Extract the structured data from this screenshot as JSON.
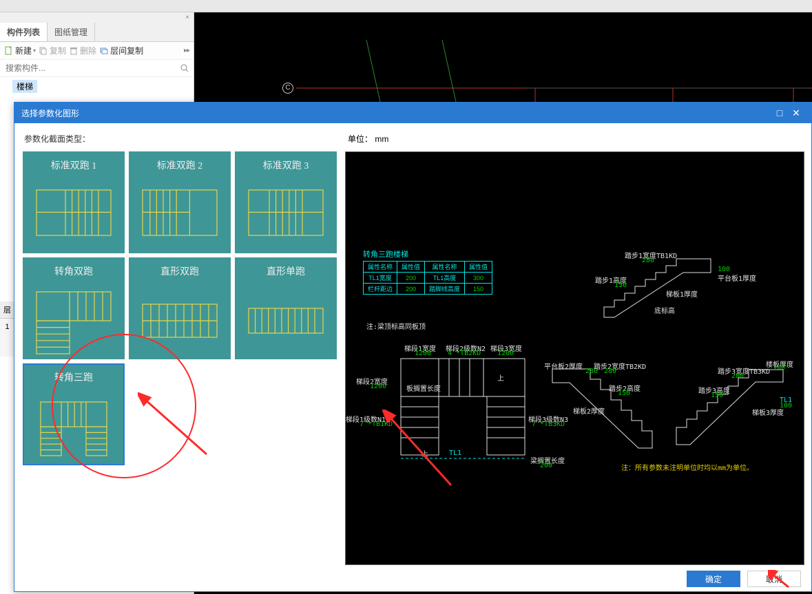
{
  "left_panel": {
    "tabs": [
      "构件列表",
      "图纸管理"
    ],
    "toolbar": {
      "new": "新建",
      "copy": "复制",
      "delete": "删除",
      "layer_copy": "层间复制"
    },
    "search_placeholder": "搜索构件...",
    "tree_item": "楼梯"
  },
  "canvas": {
    "object_label": "C"
  },
  "far_left": {
    "header": "层",
    "row": "1"
  },
  "dialog": {
    "title": "选择参数化图形",
    "left_label": "参数化截面类型：",
    "unit_label": "单位：   mm",
    "thumbs": [
      "标准双跑 1",
      "标准双跑 2",
      "标准双跑 3",
      "转角双跑",
      "直形双跑",
      "直形单跑",
      "转角三跑"
    ],
    "ok": "确定",
    "cancel": "取消"
  },
  "preview": {
    "title": "转角三跑楼梯",
    "table": {
      "headers": [
        "属性名称",
        "属性值",
        "属性名称",
        "属性值"
      ],
      "rows": [
        [
          "TL1宽度",
          "200",
          "TL1高度",
          "300"
        ],
        [
          "栏杆距边",
          "200",
          "踏脚线高度",
          "150"
        ]
      ]
    },
    "note1": "注:梁顶标高同板顶",
    "note2": "注：所有参数未注明单位时均以mm为单位。",
    "labels": {
      "stair1_width": "梯段1宽度",
      "stair1_width_v": "1200",
      "stair2_steps": "梯段2级数N2",
      "stair2_steps_v": "4  *TB2KD",
      "stair3_width": "梯段3宽度",
      "stair3_width_v": "1200",
      "stair2_width": "梯段2宽度",
      "stair2_width_v": "1200",
      "stair1_steps": "梯段1级数N1",
      "stair1_steps_v": "7  *TB1KD",
      "stair3_steps": "梯段3级数N3",
      "stair3_steps_v": "7  *TB3KD",
      "overlap_len": "梁搁置长度",
      "overlap_len_v": "200",
      "plate_len": "板搁置长度",
      "shang": "上",
      "tl1": "TL1",
      "plat2_thick": "平台板2厚度",
      "plat2_thick_v": "280",
      "step2_width": "踏步2宽度TB2KD",
      "step2_width_v": "280",
      "step2_height": "踏步2高度",
      "step2_height_v": "150",
      "stairboard2_thick": "梯板2厚度",
      "step1_width": "踏步1宽度TB1KD",
      "step1_width_v": "280",
      "step1_height": "踏步1高度",
      "step1_height_v": "150",
      "plat1_thick": "平台板1厚度",
      "plat1_thick_v": "100",
      "stairboard1_thick": "梯板1厚度",
      "bottom_elev": "底标高",
      "floor_thick": "楼板厚度",
      "floor_thick_v": "100",
      "step3_width": "踏步3宽度TB3KD",
      "step3_width_v": "280",
      "step3_height": "踏步3高度",
      "step3_height_v": "150",
      "stairboard3_thick": "梯板3厚度",
      "tll_h": "TL1",
      "tll_h_v": "100"
    }
  }
}
